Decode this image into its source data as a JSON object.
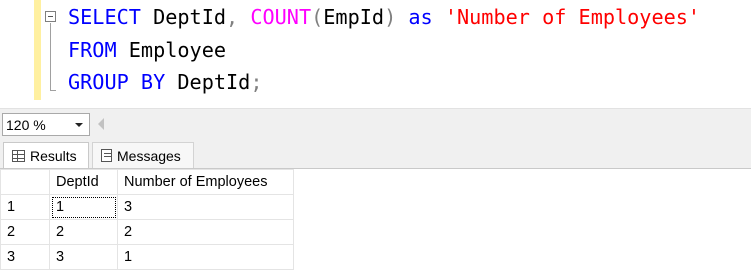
{
  "editor": {
    "line1": {
      "select_kw": "SELECT",
      "col1": "DeptId",
      "comma": ",",
      "count_fn": "COUNT",
      "open_paren": "(",
      "count_arg": "EmpId",
      "close_paren": ")",
      "as_kw": "as",
      "alias": "'Number of Employees'"
    },
    "line2": {
      "from_kw": "FROM",
      "table": "Employee"
    },
    "line3": {
      "group_kw": "GROUP BY",
      "col": "DeptId",
      "semicolon": ";"
    },
    "colors": {
      "keyword": "#0000ff",
      "function": "#ff00ff",
      "string": "#ff0000",
      "punctuation": "#808080"
    }
  },
  "zoom": {
    "value": "120 %"
  },
  "tabs": [
    {
      "label": "Results",
      "icon": "grid-icon",
      "active": true
    },
    {
      "label": "Messages",
      "icon": "messages-icon",
      "active": false
    }
  ],
  "results": {
    "columns": [
      "DeptId",
      "Number of Employees"
    ],
    "rows": [
      {
        "num": "1",
        "cells": [
          "1",
          "3"
        ]
      },
      {
        "num": "2",
        "cells": [
          "2",
          "2"
        ]
      },
      {
        "num": "3",
        "cells": [
          "3",
          "1"
        ]
      }
    ]
  }
}
